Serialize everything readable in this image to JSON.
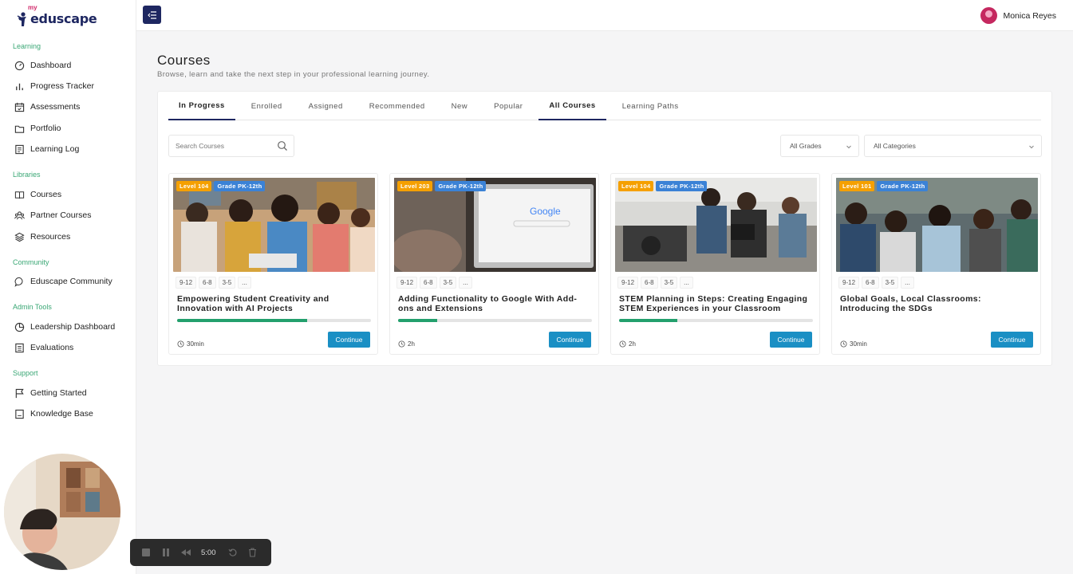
{
  "app": {
    "brand_prefix": "my",
    "brand": "eduscape"
  },
  "sidebar": {
    "sections": [
      {
        "label": "Learning",
        "items": [
          "Dashboard",
          "Progress Tracker",
          "Assessments",
          "Portfolio",
          "Learning Log"
        ]
      },
      {
        "label": "Libraries",
        "items": [
          "Courses",
          "Partner Courses",
          "Resources"
        ]
      },
      {
        "label": "Community",
        "items": [
          "Eduscape Community"
        ]
      },
      {
        "label": "Admin Tools",
        "items": [
          "Leadership Dashboard",
          "Evaluations"
        ]
      },
      {
        "label": "Support",
        "items": [
          "Getting Started",
          "Knowledge Base"
        ]
      }
    ]
  },
  "user": {
    "name": "Monica Reyes"
  },
  "page": {
    "title": "Courses",
    "subtitle": "Browse, learn and take the next step in your professional learning journey."
  },
  "tabs": [
    "In Progress",
    "Enrolled",
    "Assigned",
    "Recommended",
    "New",
    "Popular",
    "All Courses",
    "Learning Paths"
  ],
  "filters": {
    "search_placeholder": "Search Courses",
    "grades": "All Grades",
    "categories": "All Categories"
  },
  "courses": [
    {
      "level": "Level 104",
      "grade": "Grade PK-12th",
      "chips": [
        "9-12",
        "6-8",
        "3-5",
        "..."
      ],
      "title": "Empowering Student Creativity and Innovation with AI Projects",
      "progress": 0.67,
      "duration": "30min",
      "button": "Continue"
    },
    {
      "level": "Level 203",
      "grade": "Grade PK-12th",
      "chips": [
        "9-12",
        "6-8",
        "3-5",
        "..."
      ],
      "title": "Adding Functionality to Google With Add-ons and Extensions",
      "progress": 0.2,
      "duration": "2h",
      "button": "Continue"
    },
    {
      "level": "Level 104",
      "grade": "Grade PK-12th",
      "chips": [
        "9-12",
        "6-8",
        "3-5",
        "..."
      ],
      "title": "STEM Planning in Steps: Creating Engaging STEM Experiences in your Classroom",
      "progress": 0.3,
      "duration": "2h",
      "button": "Continue"
    },
    {
      "level": "Level 101",
      "grade": "Grade PK-12th",
      "chips": [
        "9-12",
        "6-8",
        "3-5",
        "..."
      ],
      "title": "Global Goals, Local Classrooms: Introducing the SDGs",
      "progress": 0,
      "duration": "30min",
      "button": "Continue"
    }
  ],
  "recorder": {
    "time": "5:00"
  },
  "colors": {
    "brand_navy": "#1e2761",
    "accent_green": "#3aa775",
    "progress_green": "#23a06d",
    "button_blue": "#1a8fc4",
    "level_orange": "#f5a000",
    "grade_blue": "#3b82d6"
  }
}
